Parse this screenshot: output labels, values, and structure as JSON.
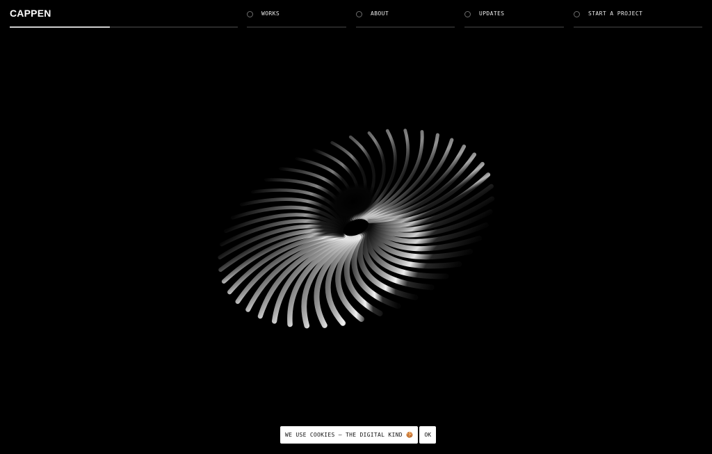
{
  "brand": {
    "logo_text": "CAPPEN"
  },
  "progress": {
    "value": 0.44
  },
  "nav": {
    "items": [
      {
        "label": "WORKS"
      },
      {
        "label": "ABOUT"
      },
      {
        "label": "UPDATES"
      },
      {
        "label": "START A PROJECT"
      }
    ]
  },
  "cookie_banner": {
    "message": "WE USE COOKIES — THE DIGITAL KIND 🍪",
    "ok_label": "OK"
  },
  "colors": {
    "background": "#000000",
    "text": "#ffffff",
    "banner_bg": "#ffffff",
    "banner_text": "#111111"
  }
}
